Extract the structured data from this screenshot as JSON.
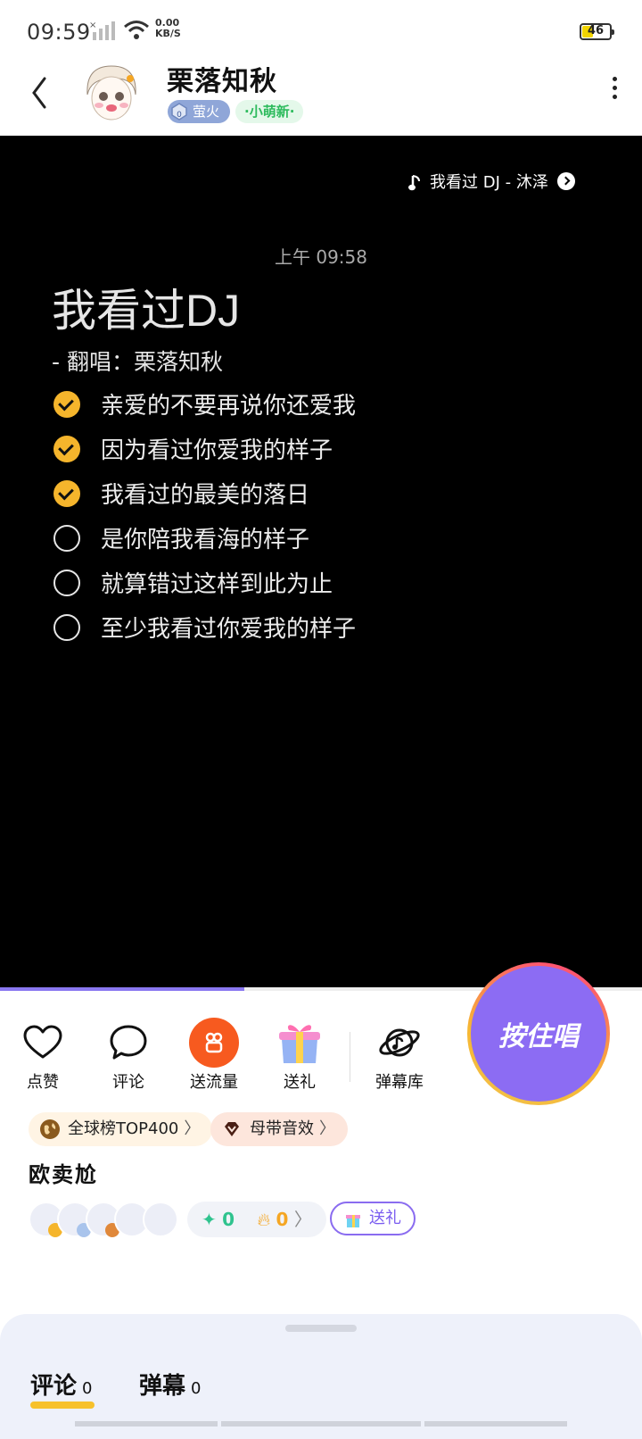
{
  "status_bar": {
    "time": "09:59",
    "net_speed_value": "0.00",
    "net_speed_unit": "KB/S",
    "battery": "46",
    "battery_level": 0.46
  },
  "header": {
    "username": "栗落知秋",
    "badge_fire": "萤火",
    "badge_new": "·小萌新·"
  },
  "post": {
    "song_chip": "我看过 DJ - 沐泽",
    "timestamp": "上午 09:58",
    "title": "我看过DJ",
    "cover_line": "-  翻唱：栗落知秋",
    "lyrics": [
      {
        "text": "亲爱的不要再说你还爱我",
        "done": true
      },
      {
        "text": "因为看过你爱我的样子",
        "done": true
      },
      {
        "text": "我看过的最美的落日",
        "done": true
      },
      {
        "text": "是你陪我看海的样子",
        "done": false
      },
      {
        "text": "就算错过这样到此为止",
        "done": false
      },
      {
        "text": "至少我看过你爱我的样子",
        "done": false
      }
    ],
    "progress": 0.38
  },
  "actions": {
    "like": "点赞",
    "comment": "评论",
    "send_traffic": "送流量",
    "gift": "送礼",
    "danmu_lib": "弹幕库",
    "hold_to_sing": "按住唱"
  },
  "chips": {
    "global_rank": "全球榜TOP400",
    "effect": "母带音效"
  },
  "section_title": "欧卖尬",
  "stats": {
    "diamonds": "0",
    "flames": "0",
    "gift_button": "送礼"
  },
  "tabs": [
    {
      "label": "评论",
      "count": "0"
    },
    {
      "label": "弹幕",
      "count": "0"
    }
  ],
  "colors": {
    "accent_purple": "#8c6cf3",
    "check_yellow": "#f5b52c",
    "orange": "#f75a1f"
  }
}
